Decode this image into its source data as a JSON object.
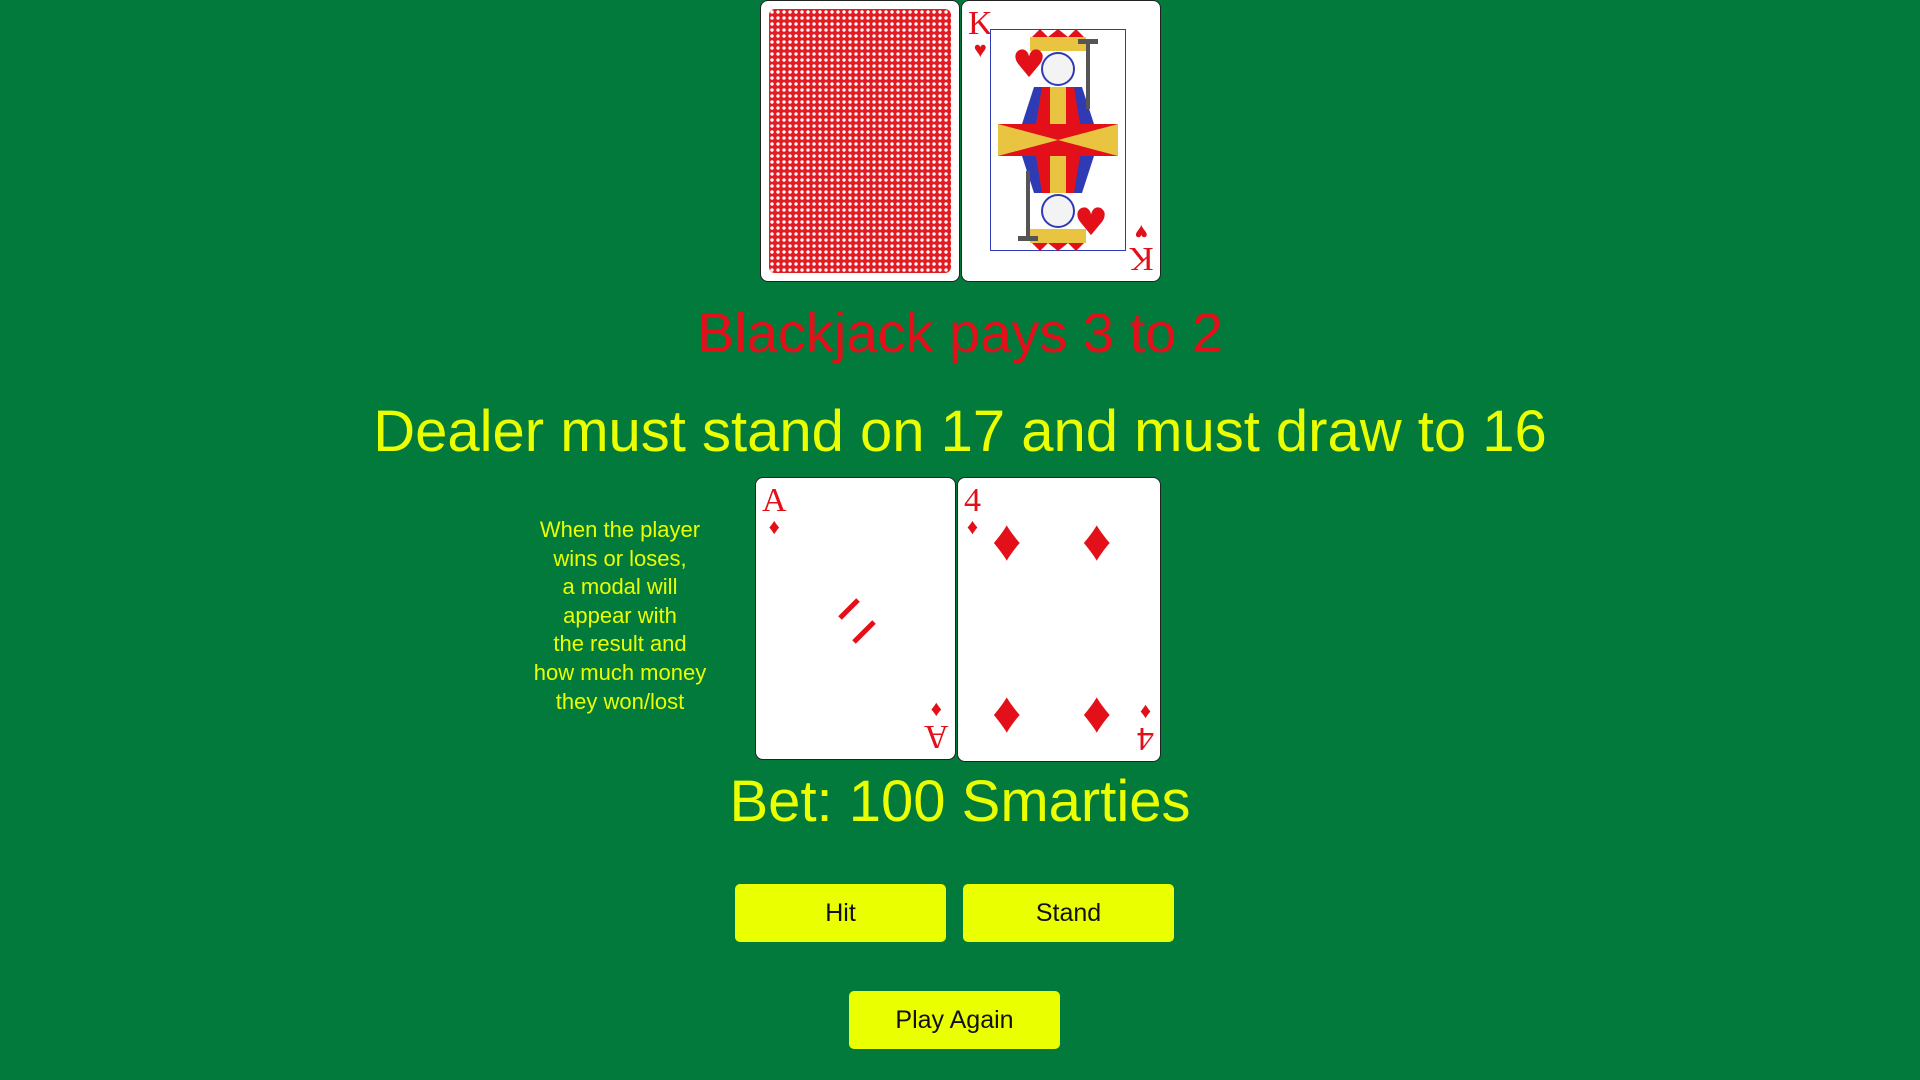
{
  "colors": {
    "felt": "#017a3c",
    "accent_yellow": "#eaff00",
    "accent_red": "#e3101a"
  },
  "dealer": {
    "cards": [
      {
        "face": "down",
        "back_color": "red"
      },
      {
        "face": "up",
        "rank": "K",
        "suit": "hearts",
        "suit_symbol": "♥"
      }
    ]
  },
  "rules": {
    "payout": "Blackjack pays 3 to 2",
    "dealer_rule": "Dealer must stand on 17 and must draw to 16"
  },
  "note": {
    "lines": [
      "When the player",
      "wins or loses,",
      "a modal will",
      "appear with",
      "the result and",
      "how much money",
      "they won/lost"
    ]
  },
  "player": {
    "cards": [
      {
        "face": "up",
        "rank": "A",
        "suit": "diamonds",
        "suit_symbol": "♦"
      },
      {
        "face": "up",
        "rank": "4",
        "suit": "diamonds",
        "suit_symbol": "♦"
      }
    ]
  },
  "bet": {
    "text": "Bet: 100 Smarties"
  },
  "buttons": {
    "hit": "Hit",
    "stand": "Stand",
    "play_again": "Play Again"
  }
}
